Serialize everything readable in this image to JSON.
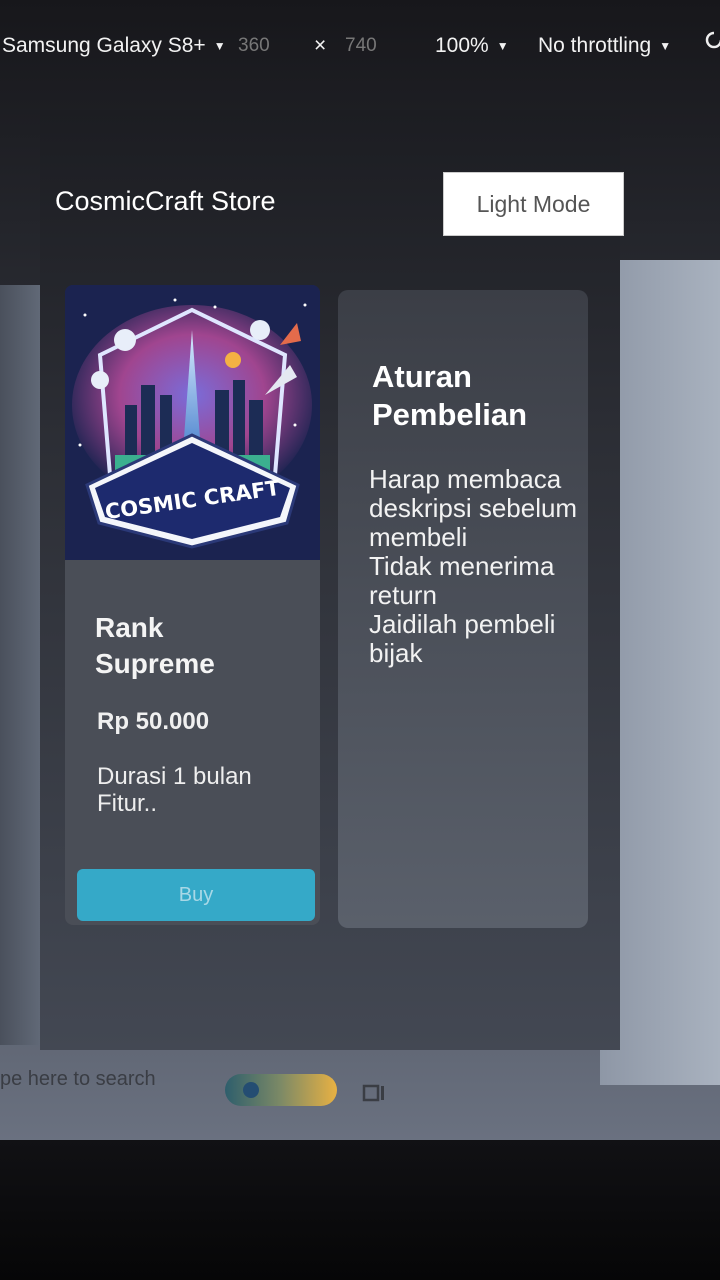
{
  "devtools": {
    "device": "Samsung Galaxy S8+",
    "width": "360",
    "times": "×",
    "height": "740",
    "zoom": "100%",
    "throttling": "No throttling",
    "caret": "▼"
  },
  "header": {
    "title": "CosmicCraft Store",
    "mode_button": "Light Mode"
  },
  "product": {
    "image_label": "COSMIC CRAFT",
    "name": "Rank Supreme",
    "price": "Rp 50.000",
    "description_line1": "Durasi 1 bulan",
    "description_line2": "Fitur..",
    "buy_label": "Buy"
  },
  "rules": {
    "title": "Aturan Pembelian",
    "lines": [
      "Harap membaca deskripsi sebelum membeli",
      "Tidak menerima return",
      "Jaidilah pembeli bijak"
    ]
  },
  "taskbar": {
    "search_placeholder": "pe here to search"
  },
  "colors": {
    "buy_button": "#35a9c8",
    "page_bg": "#2c2e35"
  }
}
